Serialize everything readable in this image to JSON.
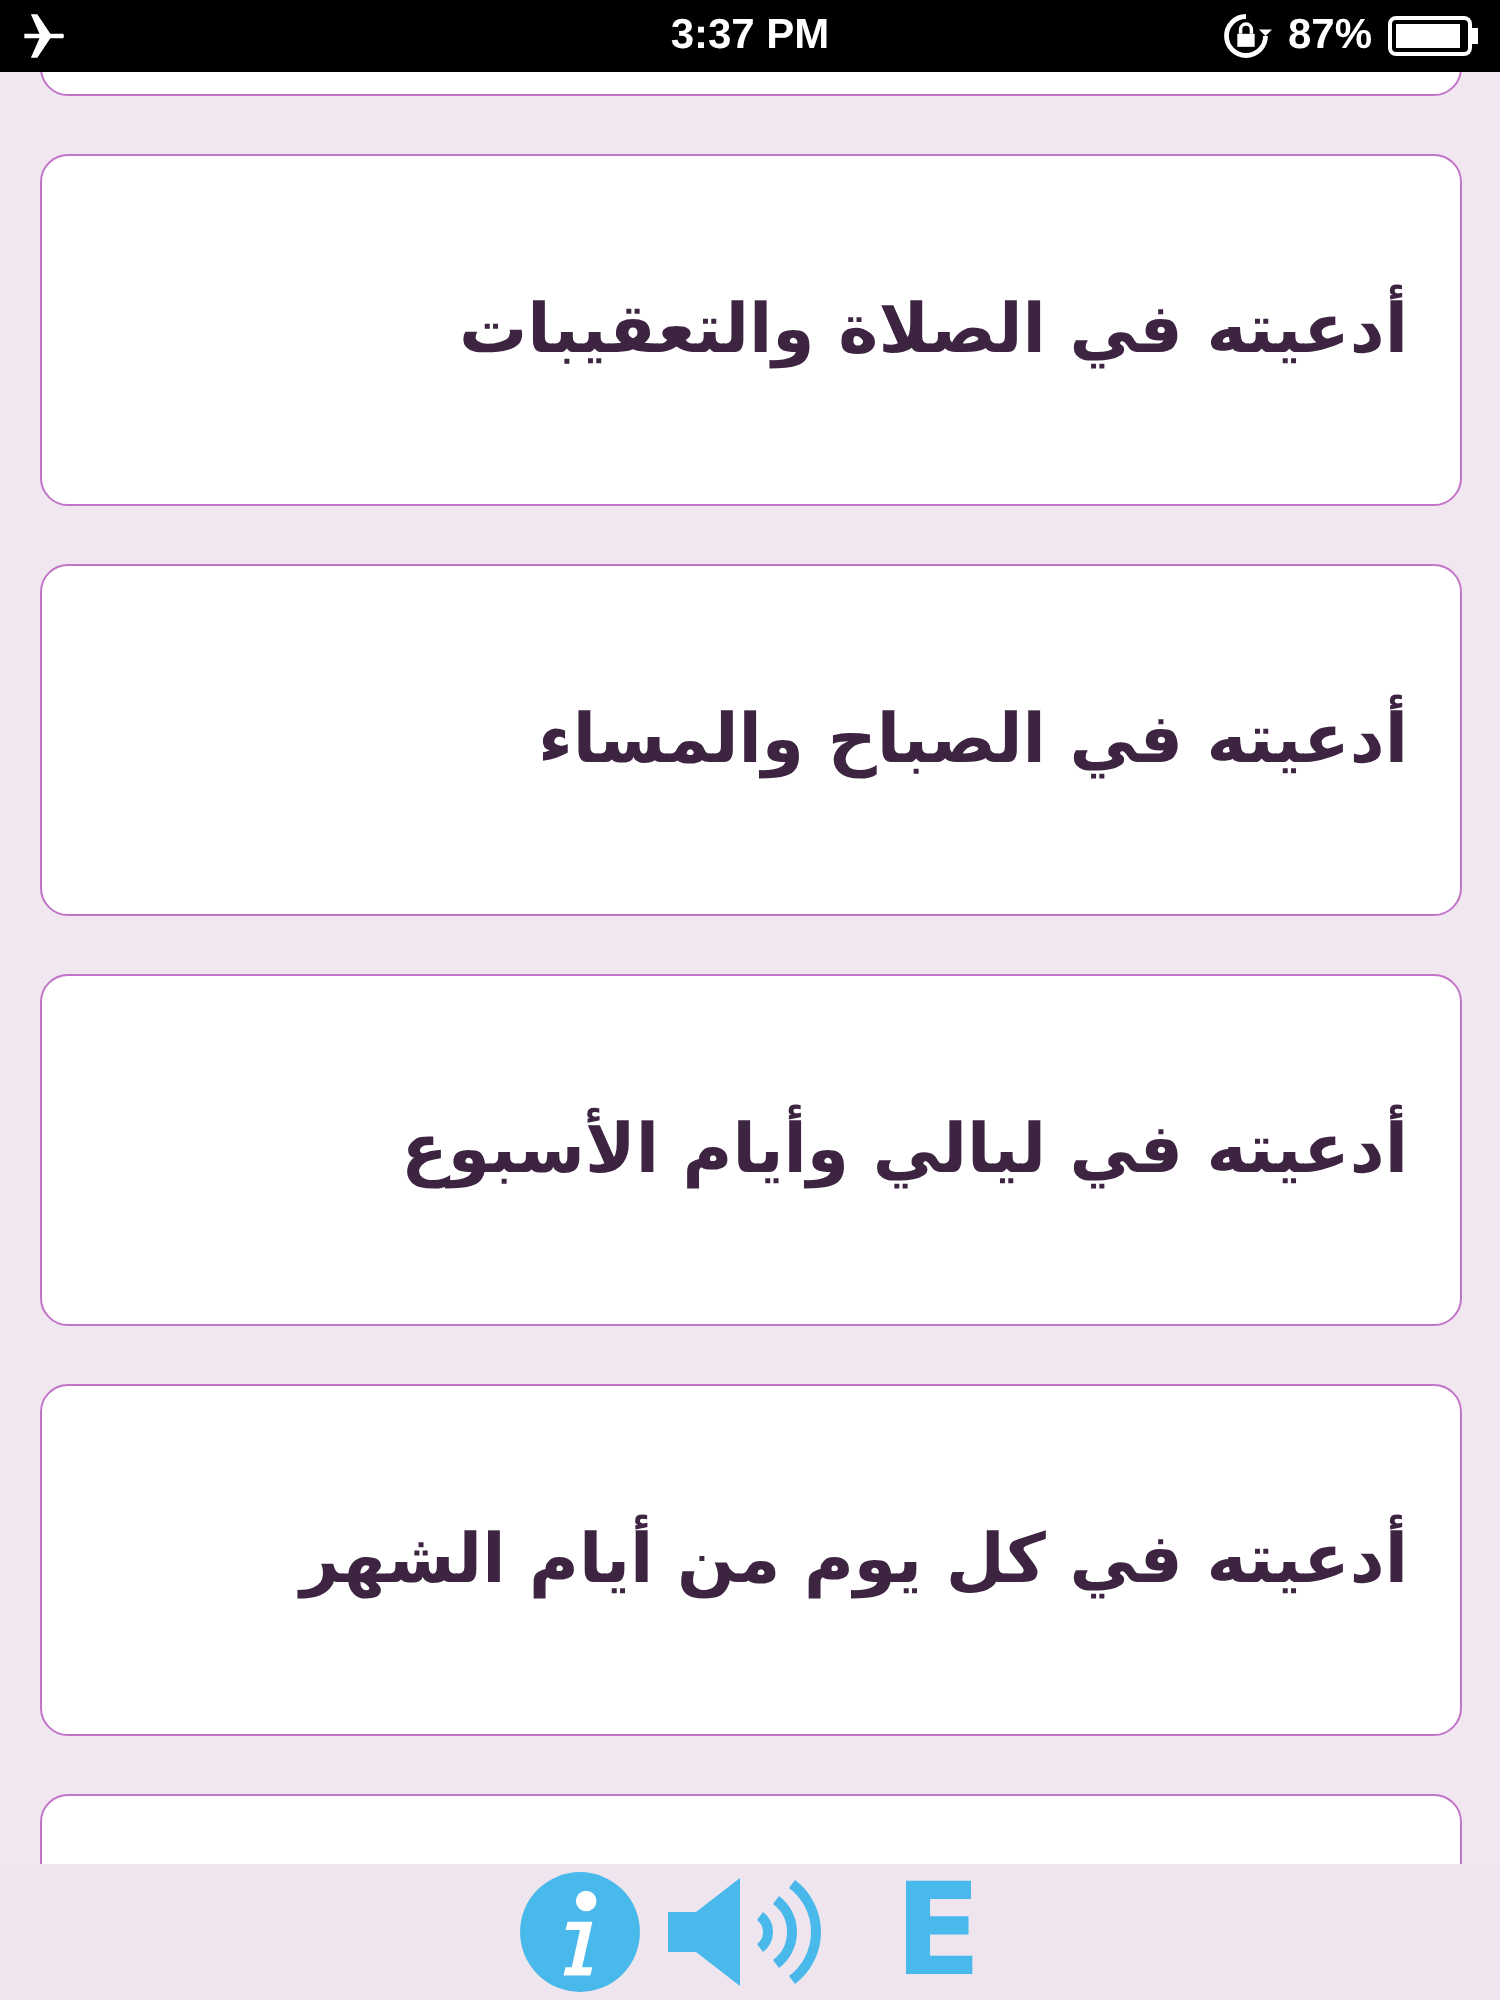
{
  "status_bar": {
    "time": "3:37 PM",
    "battery": "87%"
  },
  "items": [
    {
      "kind": "partial"
    },
    {
      "kind": "entry",
      "label": "أدعيته في الصلاة والتعقيبات"
    },
    {
      "kind": "entry",
      "label": "أدعيته في الصباح والمساء"
    },
    {
      "kind": "entry",
      "label": "أدعيته في ليالي وأيام الأسبوع"
    },
    {
      "kind": "entry",
      "label": "أدعيته في كل يوم من أيام الشهر"
    },
    {
      "kind": "partial"
    }
  ],
  "toolbar": {
    "language_button": "E"
  }
}
